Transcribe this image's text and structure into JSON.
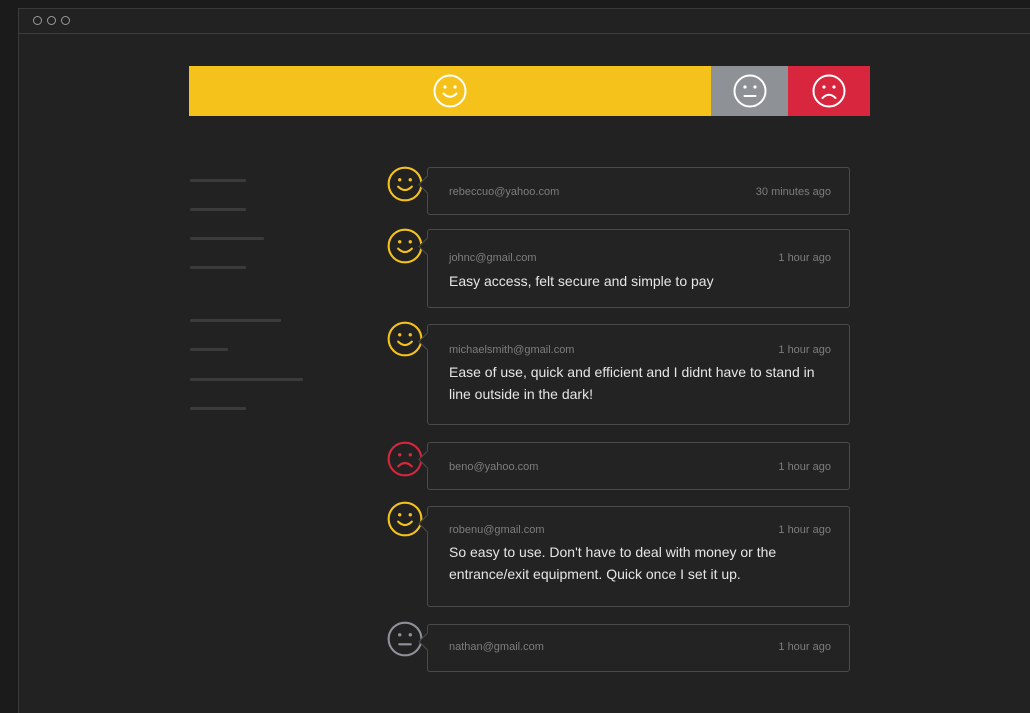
{
  "window": {
    "controls": [
      "close",
      "minimize",
      "maximize"
    ]
  },
  "sentiment_bar": {
    "segments": [
      {
        "sentiment": "happy",
        "icon": "smiley-face-icon",
        "color": "#f5c21b"
      },
      {
        "sentiment": "neutral",
        "icon": "neutral-face-icon",
        "color": "#8e9297"
      },
      {
        "sentiment": "sad",
        "icon": "sad-face-icon",
        "color": "#d7263d"
      }
    ]
  },
  "colors": {
    "happy": "#f5c21b",
    "neutral": "#8e9297",
    "sad": "#d7263d"
  },
  "feedback": [
    {
      "sentiment": "happy",
      "email": "rebeccuo@yahoo.com",
      "time": "30 minutes ago",
      "comment": ""
    },
    {
      "sentiment": "happy",
      "email": "johnc@gmail.com",
      "time": "1 hour ago",
      "comment": "Easy access, felt secure and simple to pay"
    },
    {
      "sentiment": "happy",
      "email": "michaelsmith@gmail.com",
      "time": "1 hour ago",
      "comment": "Ease of use, quick and efficient and I didnt have to stand in line outside in the dark!"
    },
    {
      "sentiment": "sad",
      "email": "beno@yahoo.com",
      "time": "1 hour ago",
      "comment": ""
    },
    {
      "sentiment": "happy",
      "email": "robenu@gmail.com",
      "time": "1 hour ago",
      "comment": "So easy to use. Don't have to deal with money or the entrance/exit equipment. Quick once I set it up."
    },
    {
      "sentiment": "neutral",
      "email": "nathan@gmail.com",
      "time": "1 hour ago",
      "comment": ""
    }
  ]
}
